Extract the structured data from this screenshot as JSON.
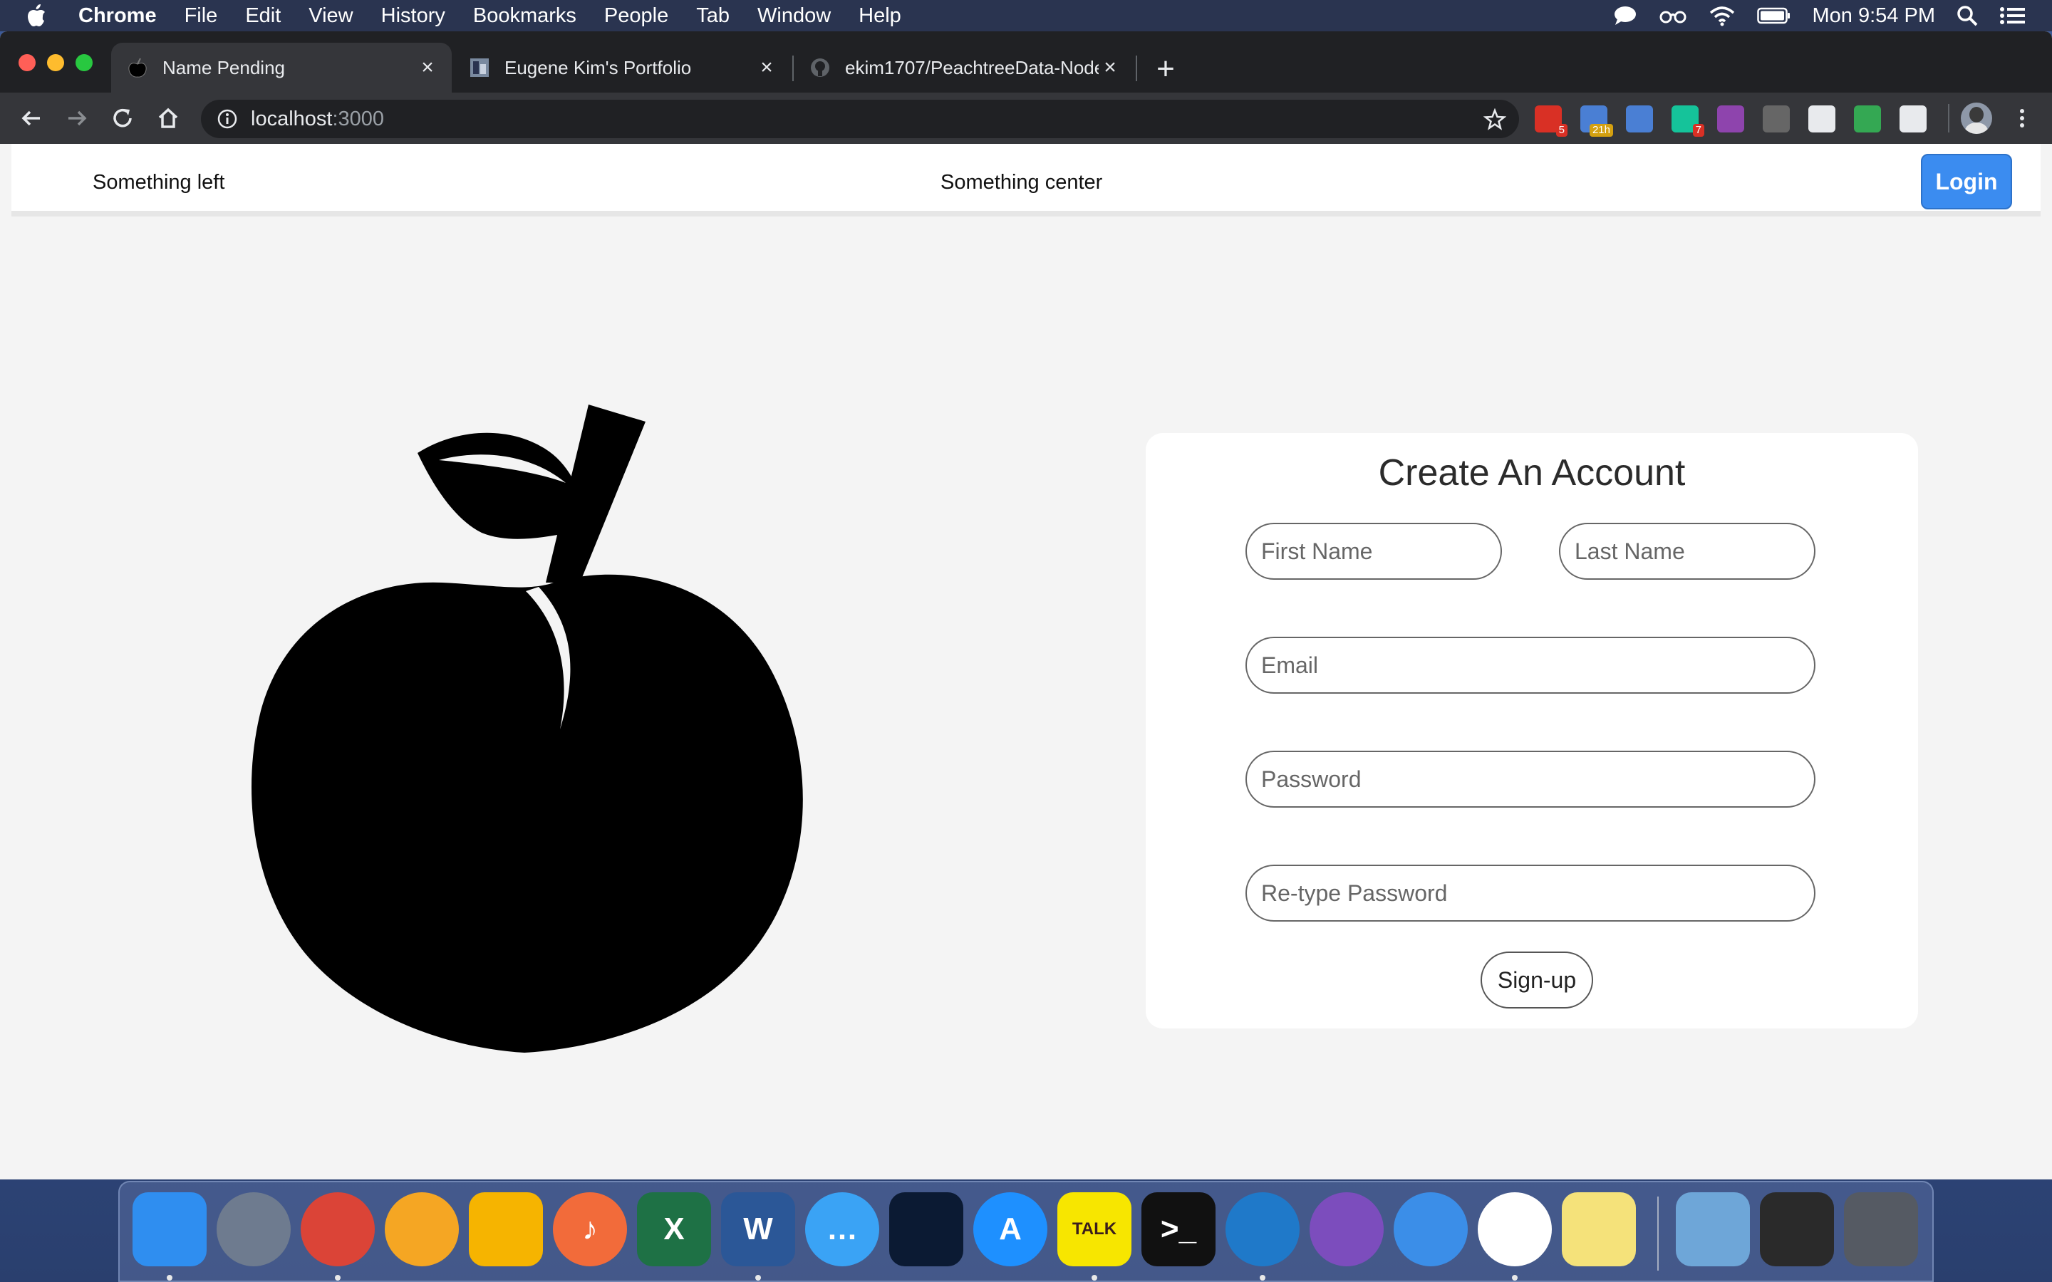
{
  "menubar": {
    "app_name": "Chrome",
    "items": [
      "File",
      "Edit",
      "View",
      "History",
      "Bookmarks",
      "People",
      "Tab",
      "Window",
      "Help"
    ],
    "clock": "Mon 9:54 PM",
    "status_icons": [
      "messages-icon",
      "glasses-icon",
      "wifi-icon",
      "battery-icon",
      "spotlight-icon",
      "control-center-icon"
    ]
  },
  "browser": {
    "tabs": [
      {
        "title": "Name Pending",
        "favicon": "apple-favicon",
        "active": true
      },
      {
        "title": "Eugene Kim's Portfolio",
        "favicon": "portfolio-favicon",
        "active": false
      },
      {
        "title": "ekim1707/PeachtreeData-Node",
        "favicon": "github-favicon",
        "active": false
      }
    ],
    "close_glyph": "×",
    "new_tab_glyph": "+",
    "url_host": "localhost",
    "url_port": ":3000",
    "extensions": [
      {
        "name": "gmail-extension",
        "badge": "5",
        "color": "#d93025"
      },
      {
        "name": "calendar-extension",
        "badge": "21h",
        "color": "#4a7fd4"
      },
      {
        "name": "translate-extension",
        "badge": "",
        "color": "#4a7fd4"
      },
      {
        "name": "grammarly-extension",
        "badge": "7",
        "color": "#15c39a"
      },
      {
        "name": "r-extension",
        "badge": "",
        "color": "#8e44ad"
      },
      {
        "name": "json-extension",
        "badge": "",
        "color": "#666666"
      },
      {
        "name": "react-devtools-extension",
        "badge": "",
        "color": "#e8eaed"
      },
      {
        "name": "green-dot-extension",
        "badge": "",
        "color": "#34a853"
      },
      {
        "name": "lock-extension",
        "badge": "",
        "color": "#e8eaed"
      }
    ]
  },
  "site": {
    "nav_left": "Something left",
    "nav_center": "Something center",
    "login_label": "Login",
    "signup": {
      "title": "Create An Account",
      "first_name_placeholder": "First Name",
      "last_name_placeholder": "Last Name",
      "email_placeholder": "Email",
      "password_placeholder": "Password",
      "retype_placeholder": "Re-type Password",
      "submit_label": "Sign-up"
    }
  },
  "dock": {
    "apps": [
      {
        "name": "finder",
        "label": "",
        "color": "#2f8ef0",
        "running": true
      },
      {
        "name": "launchpad",
        "label": "",
        "color": "#6e7b8f",
        "running": false
      },
      {
        "name": "chrome",
        "label": "",
        "color": "#db4437",
        "running": true
      },
      {
        "name": "chrome-canary",
        "label": "",
        "color": "#f5a623",
        "running": false
      },
      {
        "name": "keep",
        "label": "",
        "color": "#f6b400",
        "running": false
      },
      {
        "name": "music",
        "label": "♪",
        "color": "#f26b3a",
        "running": false
      },
      {
        "name": "excel",
        "label": "X",
        "color": "#1e7145",
        "running": false
      },
      {
        "name": "word",
        "label": "W",
        "color": "#2b5797",
        "running": true
      },
      {
        "name": "messages",
        "label": "…",
        "color": "#3aa3f5",
        "running": false
      },
      {
        "name": "kindle",
        "label": "",
        "color": "#0b1a33",
        "running": false
      },
      {
        "name": "app-store",
        "label": "A",
        "color": "#1e90ff",
        "running": false
      },
      {
        "name": "kakaotalk",
        "label": "TALK",
        "color": "#f7e600",
        "running": true
      },
      {
        "name": "terminal",
        "label": ">_",
        "color": "#111111",
        "running": false
      },
      {
        "name": "vscode",
        "label": "",
        "color": "#1f79c9",
        "running": true
      },
      {
        "name": "visual-studio",
        "label": "",
        "color": "#7c4dbd",
        "running": false
      },
      {
        "name": "tableplus",
        "label": "",
        "color": "#3b8ee8",
        "running": false
      },
      {
        "name": "slack",
        "label": "",
        "color": "#ffffff",
        "running": true
      },
      {
        "name": "stickies",
        "label": "",
        "color": "#f5e27a",
        "running": false
      }
    ],
    "right_items": [
      {
        "name": "downloads-folder",
        "color": "#6ea6d8"
      },
      {
        "name": "screen-recording",
        "color": "#2a2a2a"
      },
      {
        "name": "trash",
        "color": "#555a63"
      }
    ]
  }
}
